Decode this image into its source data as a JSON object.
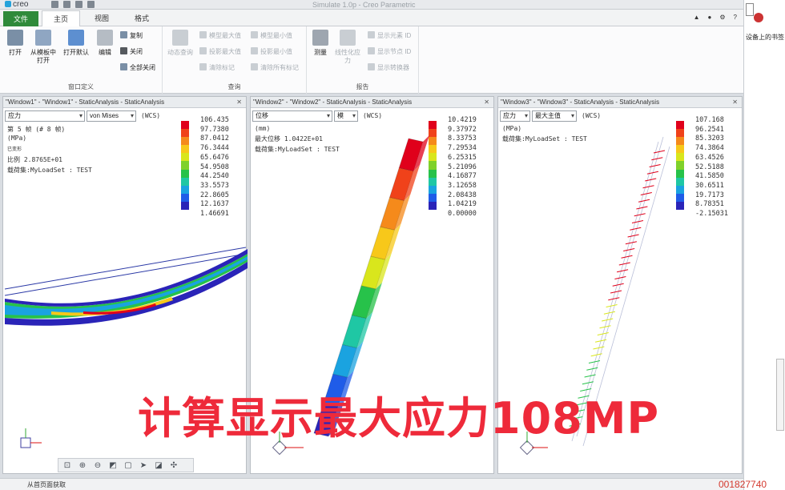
{
  "app": {
    "logo_text": "creo",
    "window_title": "Simulate 1.0p - Creo Parametric"
  },
  "tabs": {
    "file": "文件",
    "home": "主页",
    "view": "视图",
    "format": "格式"
  },
  "ribbon": {
    "window_group": {
      "label": "窗口定义",
      "open": "打开",
      "open_from_model": "从模板中打开",
      "open_default": "打开默认",
      "edit": "编辑",
      "copy": "复制",
      "close": "关闭",
      "close_all": "全部关闭"
    },
    "query_group": {
      "label": "查询",
      "dynamic_query": "动态查询",
      "model_max": "模型最大值",
      "model_min": "模型最小值",
      "proj_max": "投影最大值",
      "proj_min": "投影最小值",
      "clear_marker": "清除标记",
      "clear_all_markers": "清除所有标记"
    },
    "report_group": {
      "label": "报告",
      "measure": "测量",
      "linearize": "线性化应力",
      "show_elem_id": "显示元素 ID",
      "show_node_id": "显示节点 ID",
      "show_transform": "显示转换器"
    }
  },
  "side_panel": {
    "label": "设备上的书签"
  },
  "panes": [
    {
      "title": "\"Window1\" - \"Window1\" - StaticAnalysis - StaticAnalysis",
      "quantity": "应力",
      "component": "von Mises",
      "csys": "(WCS)",
      "info_lines": [
        "第 5 帧 (# 8 帧)",
        "(MPa)",
        "已变形",
        "比例  2.8765E+01",
        "载荷集:MyLoadSet :  TEST"
      ],
      "legend_values": [
        "106.435",
        "97.7380",
        "87.0412",
        "76.3444",
        "65.6476",
        "54.9508",
        "44.2540",
        "33.5573",
        "22.8605",
        "12.1637",
        "1.46691"
      ]
    },
    {
      "title": "\"Window2\" - \"Window2\" - StaticAnalysis - StaticAnalysis",
      "quantity": "位移",
      "component": "模",
      "csys": "(WCS)",
      "info_lines": [
        "(mm)",
        "最大位移  1.0422E+01",
        "载荷集:MyLoadSet :  TEST"
      ],
      "legend_values": [
        "10.4219",
        "9.37972",
        "8.33753",
        "7.29534",
        "6.25315",
        "5.21096",
        "4.16877",
        "3.12658",
        "2.08438",
        "1.04219",
        "0.00000"
      ]
    },
    {
      "title": "\"Window3\" - \"Window3\" - StaticAnalysis - StaticAnalysis",
      "quantity": "应力",
      "component": "最大主值",
      "csys": "(WCS)",
      "info_lines": [
        "(MPa)",
        "载荷集:MyLoadSet :  TEST"
      ],
      "legend_values": [
        "107.168",
        "96.2541",
        "85.3203",
        "74.3864",
        "63.4526",
        "52.5188",
        "41.5850",
        "30.6511",
        "19.7173",
        "8.78351",
        "-2.15031"
      ]
    }
  ],
  "legend_colors": [
    "#e0001b",
    "#f0421a",
    "#f58a1b",
    "#f7c81a",
    "#d9e61c",
    "#7fd12a",
    "#27c24a",
    "#1fc7a4",
    "#1aa3e0",
    "#1f5ce8",
    "#2a24b8"
  ],
  "status_text": "从首页面获取",
  "overlay_text": "计算显示最大应力108MP",
  "watermark_code": "001827740"
}
